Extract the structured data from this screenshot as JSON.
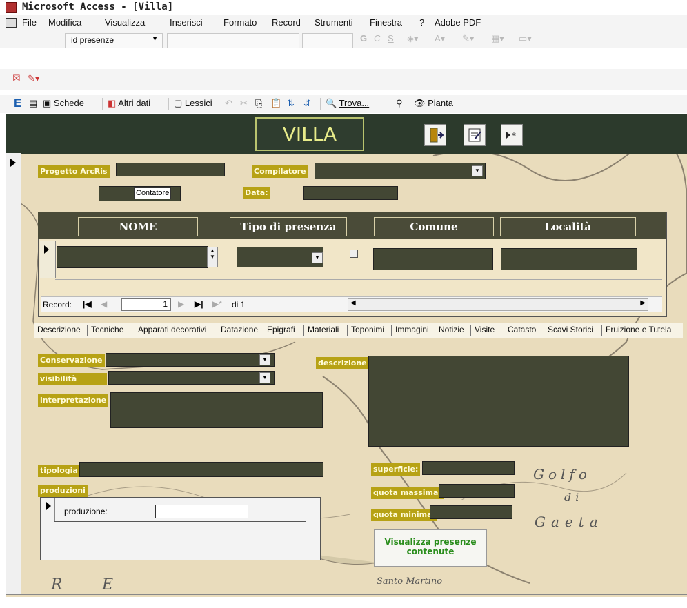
{
  "window": {
    "title": "Microsoft Access - [Villa]"
  },
  "menu": [
    {
      "label": "File"
    },
    {
      "label": "Modifica"
    },
    {
      "label": "Visualizza"
    },
    {
      "label": "Inserisci"
    },
    {
      "label": "Formato"
    },
    {
      "label": "Record"
    },
    {
      "label": "Strumenti"
    },
    {
      "label": "Finestra"
    },
    {
      "label": "?"
    },
    {
      "label": "Adobe PDF"
    }
  ],
  "format_toolbar": {
    "object_combo": "id presenze"
  },
  "toolbar": {
    "schede": "Schede",
    "altri_dati": "Altri dati",
    "lessici": "Lessici",
    "trova": "Trova...",
    "pianta": "Pianta"
  },
  "header": {
    "title": "VILLA"
  },
  "form": {
    "progetto_label": "Progetto ArcRis",
    "compilatore_label": "Compilatore",
    "contatore_label": "Contatore",
    "data_label": "Data:",
    "conservazione_label": "Conservazione",
    "visibilita_label": "visibilità",
    "interpretazione_label": "interpretazione",
    "descrizione_label": "descrizione",
    "tipologia_label": "tipologia:",
    "produzioni_label": "produzioni",
    "produzione_label": "produzione:",
    "superficie_label": "superficie:",
    "quota_massima_label": "quota massima:",
    "quota_minima_label": "quota minima:",
    "visualizza_button": "Visualizza presenze contenute"
  },
  "subform": {
    "columns": [
      "NOME",
      "Tipo di presenza",
      "Comune",
      "Località"
    ],
    "nav": {
      "record_label": "Record:",
      "current": "1",
      "of_text": "di 1"
    }
  },
  "tabs": [
    "Descrizione",
    "Tecniche",
    "Apparati decorativi",
    "Datazione",
    "Epigrafi",
    "Materiali",
    "Toponimi",
    "Immagini",
    "Notizie",
    "Visite",
    "Catasto",
    "Scavi Storici",
    "Fruizione e Tutela"
  ],
  "map_text": {
    "golfo": "Golfo",
    "di": "di",
    "gaeta": "Gaeta",
    "santo": "Santo Martino",
    "r": "R",
    "e": "E"
  },
  "colors": {
    "label_bg": "#b7a215",
    "field_bg": "#434734",
    "header_bg": "#2c3a2c",
    "villa_text": "#e7eb8a"
  }
}
